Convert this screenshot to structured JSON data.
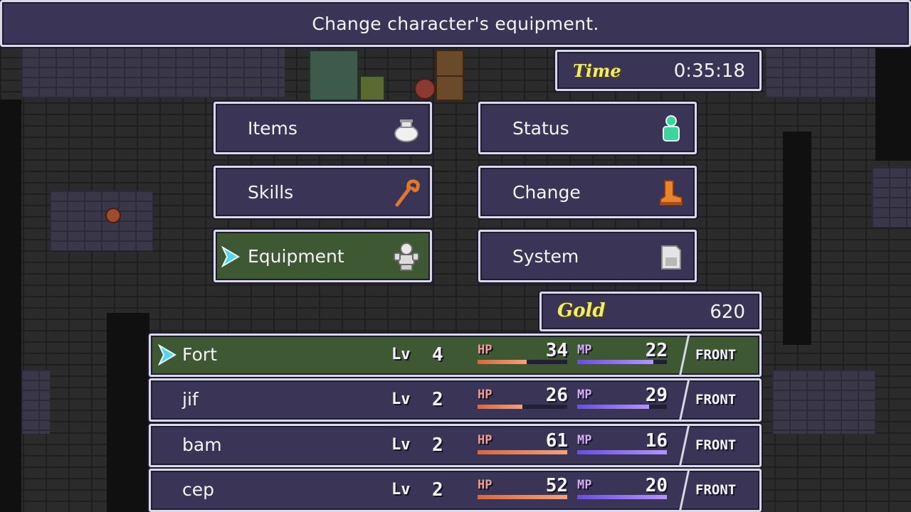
{
  "help": {
    "text": "Change character's equipment."
  },
  "time": {
    "label": "Time",
    "value": "0:35:18"
  },
  "gold": {
    "label": "Gold",
    "value": "620"
  },
  "commands": [
    {
      "label": "Items",
      "icon": "bag-icon",
      "active": false
    },
    {
      "label": "Status",
      "icon": "person-icon",
      "active": false
    },
    {
      "label": "Skills",
      "icon": "staff-icon",
      "active": false
    },
    {
      "label": "Change",
      "icon": "boots-icon",
      "active": false
    },
    {
      "label": "Equipment",
      "icon": "armor-icon",
      "active": true
    },
    {
      "label": "System",
      "icon": "save-card-icon",
      "active": false
    }
  ],
  "party": {
    "lv_label": "Lv",
    "hp_label": "HP",
    "mp_label": "MP",
    "members": [
      {
        "name": "Fort",
        "lv": "4",
        "hp": "34",
        "hp_frac": 0.55,
        "mp": "22",
        "mp_frac": 0.85,
        "row": "FRONT"
      },
      {
        "name": "jif",
        "lv": "2",
        "hp": "26",
        "hp_frac": 0.5,
        "mp": "29",
        "mp_frac": 0.8,
        "row": "FRONT"
      },
      {
        "name": "bam",
        "lv": "2",
        "hp": "61",
        "hp_frac": 1.0,
        "mp": "16",
        "mp_frac": 1.0,
        "row": "FRONT"
      },
      {
        "name": "cep",
        "lv": "2",
        "hp": "52",
        "hp_frac": 1.0,
        "mp": "20",
        "mp_frac": 1.0,
        "row": "FRONT"
      }
    ]
  },
  "colors": {
    "window": "#3a3557",
    "active": "#3e5834",
    "border": "#d9d9e6",
    "title_gold": "#f1e97a"
  }
}
